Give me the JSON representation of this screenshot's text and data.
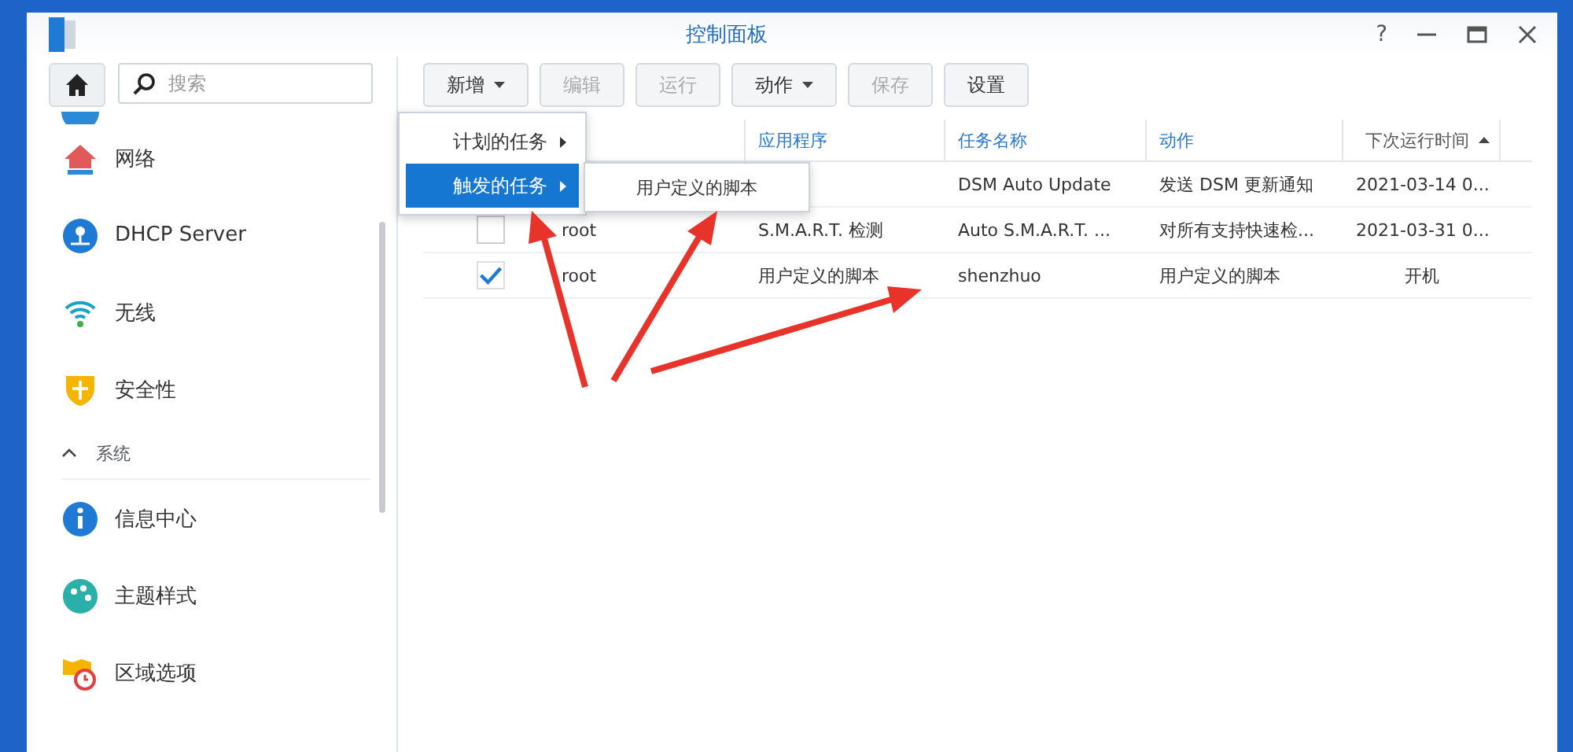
{
  "window": {
    "title": "控制面板",
    "help": "?"
  },
  "search": {
    "placeholder": "搜索"
  },
  "sidebar": {
    "items": [
      {
        "label": "网络"
      },
      {
        "label": "DHCP Server"
      },
      {
        "label": "无线"
      },
      {
        "label": "安全性"
      }
    ],
    "section": {
      "label": "系统",
      "expanded": true,
      "items": [
        {
          "label": "信息中心"
        },
        {
          "label": "主题样式"
        },
        {
          "label": "区域选项"
        }
      ]
    }
  },
  "toolbar": [
    {
      "label": "新增",
      "disabled": false,
      "dropdown": true
    },
    {
      "label": "编辑",
      "disabled": true,
      "dropdown": false
    },
    {
      "label": "运行",
      "disabled": true,
      "dropdown": false
    },
    {
      "label": "动作",
      "disabled": false,
      "dropdown": true
    },
    {
      "label": "保存",
      "disabled": true,
      "dropdown": false
    },
    {
      "label": "设置",
      "disabled": false,
      "dropdown": false
    }
  ],
  "menu": {
    "items": [
      {
        "label": "计划的任务",
        "selected": false
      },
      {
        "label": "触发的任务",
        "selected": true
      }
    ],
    "submenu": {
      "items": [
        "用户定义的脚本"
      ]
    }
  },
  "table": {
    "columns": [
      {
        "label": "应用程序",
        "sorted": false
      },
      {
        "label": "任务名称",
        "sorted": false
      },
      {
        "label": "动作",
        "sorted": false
      },
      {
        "label": "下次运行时间",
        "sorted": true
      }
    ],
    "rows": [
      {
        "cells": [
          "",
          "DSM Auto Update",
          "发送 DSM 更新通知",
          "2021-03-14 0..."
        ]
      },
      {
        "checked": false,
        "owner": "root",
        "cells": [
          "S.M.A.R.T. 检测",
          "Auto S.M.A.R.T. ...",
          "对所有支持快速检...",
          "2021-03-31 0..."
        ]
      },
      {
        "checked": true,
        "owner": "root",
        "cells": [
          "用户定义的脚本",
          "shenzhuo",
          "用户定义的脚本",
          "开机"
        ]
      }
    ]
  }
}
